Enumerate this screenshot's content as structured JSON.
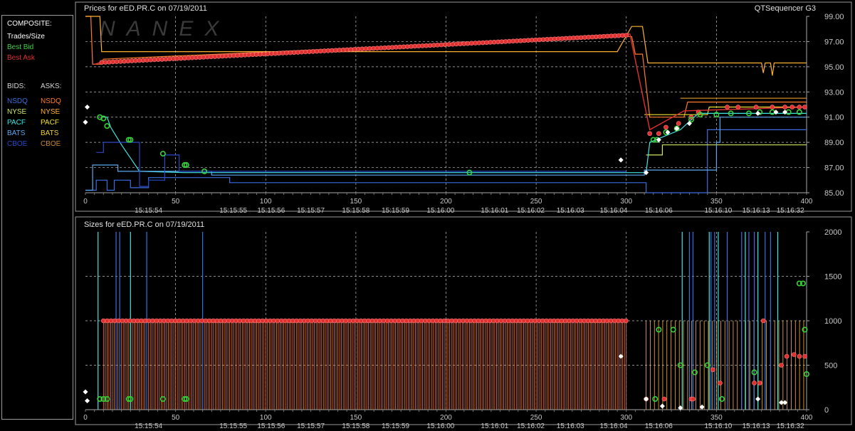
{
  "colors": {
    "background": "#000000",
    "axis": "#a8a8a8",
    "grid": "#bfbfbf",
    "best_bid": "#37d337",
    "best_ask": "#e03030",
    "nsdq_bid": "#3a6ee0",
    "nyse_bid": "#cfe85a",
    "pacf_bid": "#3ee6e6",
    "bats_bid": "#5aa9f0",
    "cboe_bid": "#2a47c8",
    "nsdq_ask": "#ff7a2a",
    "nyse_ask": "#ffb030",
    "pacf_ask": "#f0e030",
    "bats_ask": "#f0d040",
    "cboe_ask": "#c88a2a"
  },
  "logo_text": "NANEX",
  "legend": {
    "composite": "COMPOSITE:",
    "trades": "Trades/Size",
    "best_bid": "Best Bid",
    "best_ask": "Best Ask",
    "bids_head": "BIDS:",
    "asks_head": "ASKS:",
    "bids": [
      "NSDQ",
      "NYSE",
      "PACF",
      "BATS",
      "CBOE"
    ],
    "asks": [
      "NSDQ",
      "NYSE",
      "PACF",
      "BATS",
      "CBOE"
    ]
  },
  "chart_data": [
    {
      "type": "line",
      "title": "Prices for  eED.PR.C  on  07/19/2011",
      "title_right": "QTSequencer G3",
      "xlim": [
        0,
        400
      ],
      "ylim": [
        85,
        99
      ],
      "x_ticks": [
        0,
        50,
        100,
        150,
        200,
        250,
        300,
        350,
        400
      ],
      "y_ticks": [
        "85.00",
        "87.00",
        "89.00",
        "91.00",
        "93.00",
        "95.00",
        "97.00",
        "99.00"
      ],
      "time_labels": [
        {
          "x": 35,
          "t": "15:15:54"
        },
        {
          "x": 82,
          "t": "15:15:55"
        },
        {
          "x": 103,
          "t": "15:15:56"
        },
        {
          "x": 125,
          "t": "15:15:57"
        },
        {
          "x": 150,
          "t": "15:15:58"
        },
        {
          "x": 172,
          "t": "15:15:59"
        },
        {
          "x": 197,
          "t": "15:16:00"
        },
        {
          "x": 227,
          "t": "15:16:01"
        },
        {
          "x": 247,
          "t": "15:16:02"
        },
        {
          "x": 269,
          "t": "15:16:03"
        },
        {
          "x": 293,
          "t": "15:16:04"
        },
        {
          "x": 318,
          "t": "15:16:06"
        },
        {
          "x": 351,
          "t": "15:16:10"
        },
        {
          "x": 372,
          "t": "15:16:13"
        },
        {
          "x": 391,
          "t": "15:16:32"
        }
      ],
      "series": [
        {
          "key": "nsdq_ask",
          "points": [
            [
              0,
              99
            ],
            [
              3,
              99
            ],
            [
              4,
              95.2
            ],
            [
              9,
              95.2
            ],
            [
              10,
              95.6
            ],
            [
              298,
              97.4
            ],
            [
              303,
              97.4
            ],
            [
              305,
              96
            ],
            [
              309,
              96
            ],
            [
              313,
              91
            ],
            [
              332,
              91
            ],
            [
              334,
              92.2
            ],
            [
              400,
              92.2
            ]
          ]
        },
        {
          "key": "nyse_ask",
          "points": [
            [
              0,
              99
            ],
            [
              8,
              99
            ],
            [
              9,
              96.2
            ],
            [
              295,
              96.2
            ],
            [
              303,
              98.2
            ],
            [
              309,
              98.2
            ],
            [
              312,
              95.3
            ],
            [
              375,
              95.3
            ],
            [
              376,
              94.5
            ],
            [
              377,
              95.3
            ],
            [
              380,
              95.3
            ],
            [
              381,
              94.3
            ],
            [
              382,
              95.3
            ],
            [
              400,
              95.3
            ]
          ]
        },
        {
          "key": "pacf_ask",
          "points": [
            [
              310,
              91.2
            ],
            [
              345,
              91.2
            ],
            [
              346,
              91.8
            ],
            [
              400,
              91.8
            ]
          ]
        },
        {
          "key": "cboe_ask",
          "points": [
            [
              330,
              92.5
            ],
            [
              400,
              92.5
            ]
          ]
        },
        {
          "key": "nsdq_bid",
          "points": [
            [
              0,
              85.2
            ],
            [
              6,
              85.2
            ],
            [
              6,
              86
            ],
            [
              12,
              86
            ],
            [
              12,
              85.2
            ],
            [
              16,
              85.2
            ],
            [
              16,
              86
            ],
            [
              25,
              86
            ],
            [
              25,
              85.4
            ],
            [
              35,
              85.4
            ],
            [
              35,
              86.2
            ],
            [
              80,
              86.2
            ],
            [
              80,
              85.8
            ],
            [
              300,
              85.8
            ],
            [
              311,
              85.8
            ],
            [
              311,
              85
            ],
            [
              345,
              85
            ],
            [
              345,
              90
            ],
            [
              400,
              90
            ]
          ]
        },
        {
          "key": "nyse_bid",
          "points": [
            [
              311,
              88
            ],
            [
              320,
              88
            ],
            [
              320,
              88.8
            ],
            [
              400,
              88.8
            ]
          ]
        },
        {
          "key": "pacf_bid",
          "points": [
            [
              10,
              91
            ],
            [
              12,
              91
            ],
            [
              14,
              90.2
            ],
            [
              20,
              88.8
            ],
            [
              30,
              86.7
            ],
            [
              55,
              86.6
            ],
            [
              300,
              86.6
            ],
            [
              311,
              86.6
            ],
            [
              313,
              89
            ],
            [
              330,
              90
            ],
            [
              340,
              91.3
            ],
            [
              400,
              91.3
            ]
          ]
        },
        {
          "key": "bats_bid",
          "points": [
            [
              0,
              85.2
            ],
            [
              4,
              85.2
            ],
            [
              4,
              87.2
            ],
            [
              18,
              87.2
            ],
            [
              18,
              86.7
            ],
            [
              70,
              86.7
            ],
            [
              70,
              86.4
            ],
            [
              310,
              86.4
            ],
            [
              310,
              86.8
            ],
            [
              350,
              86.8
            ],
            [
              350,
              89
            ],
            [
              352,
              89
            ],
            [
              352,
              91
            ],
            [
              400,
              91
            ]
          ]
        },
        {
          "key": "cboe_bid",
          "points": [
            [
              6,
              88.2
            ],
            [
              10,
              88.2
            ],
            [
              10,
              89
            ],
            [
              30,
              89
            ],
            [
              30,
              85.5
            ],
            [
              35,
              85.5
            ],
            [
              35,
              86
            ],
            [
              44,
              86
            ],
            [
              44,
              88
            ],
            [
              52,
              88
            ],
            [
              52,
              86.7
            ],
            [
              300,
              86.7
            ]
          ]
        }
      ],
      "best_ask_path": [
        [
          5,
          95.2
        ],
        [
          10,
          95.4
        ],
        [
          298,
          97.6
        ],
        [
          302,
          97.6
        ],
        [
          313,
          90
        ],
        [
          332,
          91.5
        ],
        [
          400,
          91.8
        ]
      ],
      "best_ask_markers": {
        "x_range": [
          9,
          300
        ],
        "count": 140,
        "extra": [
          [
            313,
            89.7
          ],
          [
            318,
            89.7
          ],
          [
            322,
            90.2
          ],
          [
            329,
            90.5
          ],
          [
            336,
            91
          ],
          [
            340,
            91.4
          ],
          [
            356,
            91.8
          ],
          [
            362,
            91.8
          ],
          [
            372,
            91.8
          ],
          [
            381,
            91.8
          ],
          [
            388,
            91.8
          ],
          [
            392,
            91.8
          ],
          [
            396,
            91.8
          ],
          [
            399,
            91.8
          ]
        ]
      },
      "best_bid_markers": [
        [
          8,
          91
        ],
        [
          10,
          90.9
        ],
        [
          12,
          90.3
        ],
        [
          24,
          89.2
        ],
        [
          25,
          89.2
        ],
        [
          43,
          88.1
        ],
        [
          55,
          87.2
        ],
        [
          56,
          87.2
        ],
        [
          66,
          86.7
        ],
        [
          213,
          86.6
        ],
        [
          315,
          89.2
        ],
        [
          317,
          89.2
        ],
        [
          322,
          89.8
        ],
        [
          328,
          90.1
        ],
        [
          336,
          90.8
        ],
        [
          341,
          91.2
        ],
        [
          350,
          91.2
        ],
        [
          358,
          91.3
        ],
        [
          368,
          91.3
        ],
        [
          374,
          91.4
        ],
        [
          381,
          91.4
        ],
        [
          390,
          91.4
        ],
        [
          396,
          91.4
        ]
      ],
      "trade_points": [
        [
          0,
          90.6
        ],
        [
          1,
          91.8
        ],
        [
          297,
          87.6
        ],
        [
          311,
          86.6
        ],
        [
          318,
          89.2
        ],
        [
          323,
          89.8
        ],
        [
          328,
          90.1
        ],
        [
          335,
          90.5
        ],
        [
          373,
          91.3
        ],
        [
          383,
          91.4
        ],
        [
          388,
          91.4
        ]
      ]
    },
    {
      "type": "bar",
      "title": "Sizes for  eED.PR.C  on  07/19/2011",
      "xlim": [
        0,
        400
      ],
      "ylim": [
        0,
        2000
      ],
      "x_ticks": [
        0,
        50,
        100,
        150,
        200,
        250,
        300,
        350,
        400
      ],
      "y_ticks": [
        "0",
        "500",
        "1000",
        "1500",
        "2000"
      ],
      "ask_size_level": 1000,
      "ask_size_range": [
        10,
        300
      ],
      "bid_spikes_x": [
        7,
        17,
        19,
        25,
        34,
        65,
        331,
        335,
        337,
        346,
        347,
        349,
        351,
        356,
        364,
        366,
        368,
        371,
        373,
        377,
        380,
        384
      ],
      "bid_size_markers": [
        [
          8,
          120
        ],
        [
          10,
          120
        ],
        [
          12,
          120
        ],
        [
          24,
          120
        ],
        [
          25,
          120
        ],
        [
          43,
          120
        ],
        [
          55,
          120
        ],
        [
          56,
          120
        ],
        [
          316,
          120
        ],
        [
          318,
          900
        ],
        [
          326,
          900
        ],
        [
          330,
          500
        ],
        [
          338,
          420
        ],
        [
          345,
          500
        ],
        [
          353,
          120
        ],
        [
          371,
          420
        ],
        [
          396,
          1420
        ],
        [
          398,
          1420
        ],
        [
          399,
          900
        ],
        [
          400,
          400
        ]
      ],
      "ask_size_markers_extra": [
        [
          311,
          120
        ],
        [
          321,
          120
        ],
        [
          336,
          120
        ],
        [
          337,
          120
        ],
        [
          348,
          450
        ],
        [
          352,
          300
        ],
        [
          371,
          300
        ],
        [
          374,
          300
        ],
        [
          376,
          1000
        ],
        [
          386,
          500
        ],
        [
          389,
          600
        ],
        [
          393,
          620
        ],
        [
          396,
          600
        ],
        [
          399,
          600
        ]
      ],
      "trade_size_points": [
        [
          0,
          200
        ],
        [
          1,
          100
        ],
        [
          297,
          600
        ],
        [
          311,
          120
        ],
        [
          320,
          40
        ],
        [
          330,
          20
        ],
        [
          342,
          30
        ],
        [
          373,
          120
        ],
        [
          386,
          80
        ],
        [
          388,
          80
        ]
      ]
    }
  ]
}
